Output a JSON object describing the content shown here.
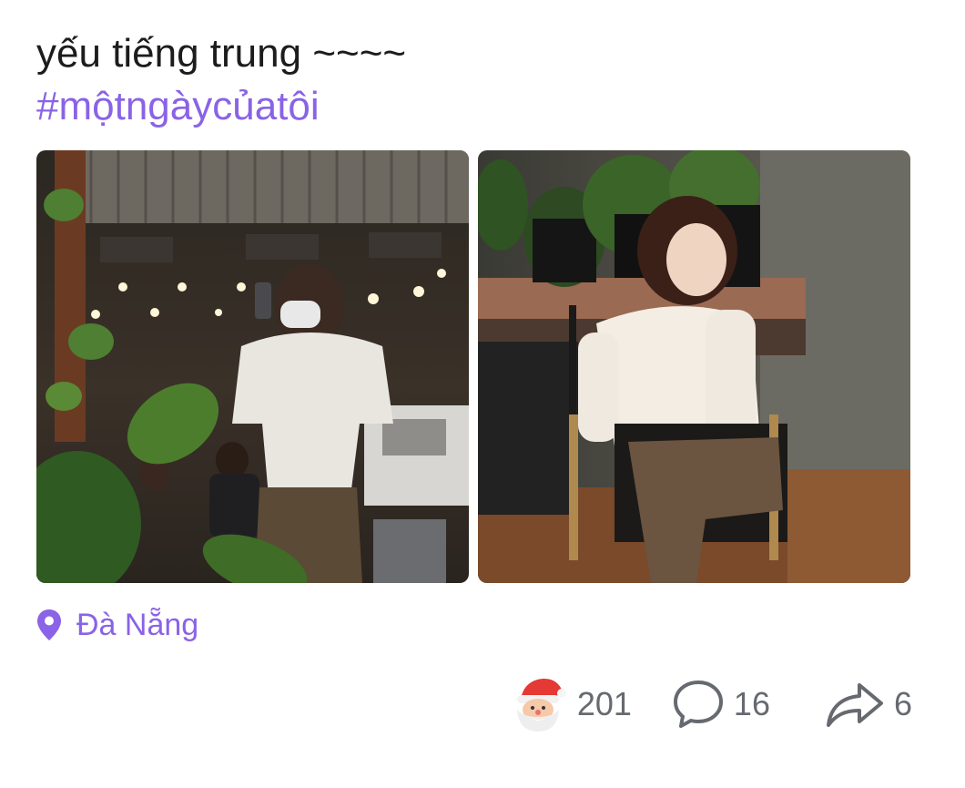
{
  "post": {
    "caption": "yếu tiếng trung ~~~~",
    "hashtag": "#mộtngàycủatôi",
    "location": "Đà Nẵng"
  },
  "photos": [
    {
      "alt": "woman in white top taking mirror selfie in a plant-filled cafe at night",
      "icon": "photo"
    },
    {
      "alt": "woman in white top seated on a chair beside potted plants",
      "icon": "photo"
    }
  ],
  "stats": {
    "likes": "201",
    "comments": "16",
    "shares": "6"
  },
  "icons": {
    "location": "location-pin-icon",
    "like": "santa-reaction-icon",
    "comment": "comment-bubble-icon",
    "share": "share-arrow-icon"
  },
  "colors": {
    "accent": "#8a63e6",
    "text": "#1c1c1c",
    "muted": "#666a70"
  }
}
